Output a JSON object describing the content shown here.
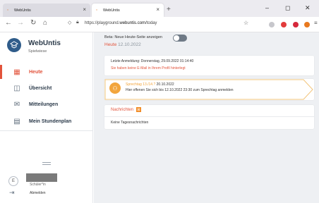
{
  "browser": {
    "tabs": [
      {
        "title": "WebUntis"
      },
      {
        "title": "WebUntis"
      }
    ],
    "url_prefix": "https://playground.",
    "url_host": "webuntis.com",
    "url_path": "/today",
    "new_tab_label": "+",
    "colors": {
      "ext1": "#c7c7cc",
      "ext2": "#e23b3b",
      "ext3": "#d6283b",
      "ext4": "#e8791f"
    }
  },
  "sidebar": {
    "app_name": "WebUntis",
    "school": "Spielwiese",
    "items": [
      {
        "label": "Heute",
        "icon": "today-grid-icon"
      },
      {
        "label": "Übersicht",
        "icon": "overview-icon"
      },
      {
        "label": "Mitteilungen",
        "icon": "messages-icon"
      },
      {
        "label": "Mein Stundenplan",
        "icon": "timetable-icon"
      }
    ],
    "user_initial": "E",
    "user_role": "Schüler*in",
    "logout_label": "Abmelden"
  },
  "main": {
    "toggle_label": "Beta: Neue Heute-Seite anzeigen",
    "today_label": "Heute",
    "today_date": "12.10.2022",
    "last_login": "Letzte Anmeldung: Donnerstag, 29.09.2022 01:14:40",
    "warning": "Sie haben keine E-Mail in Ihrem Profil hinterlegt",
    "consult_title": "Sprechtag 13./14.?",
    "consult_date": "20.10.2022",
    "consult_desc": "Hier offenen Sie sich bis 12.10.2022 23:30 zum Sprechtag anmelden",
    "news_title": "Nachrichten",
    "news_badge": "⊠",
    "news_empty": "Keine Tagesnachrichten"
  }
}
